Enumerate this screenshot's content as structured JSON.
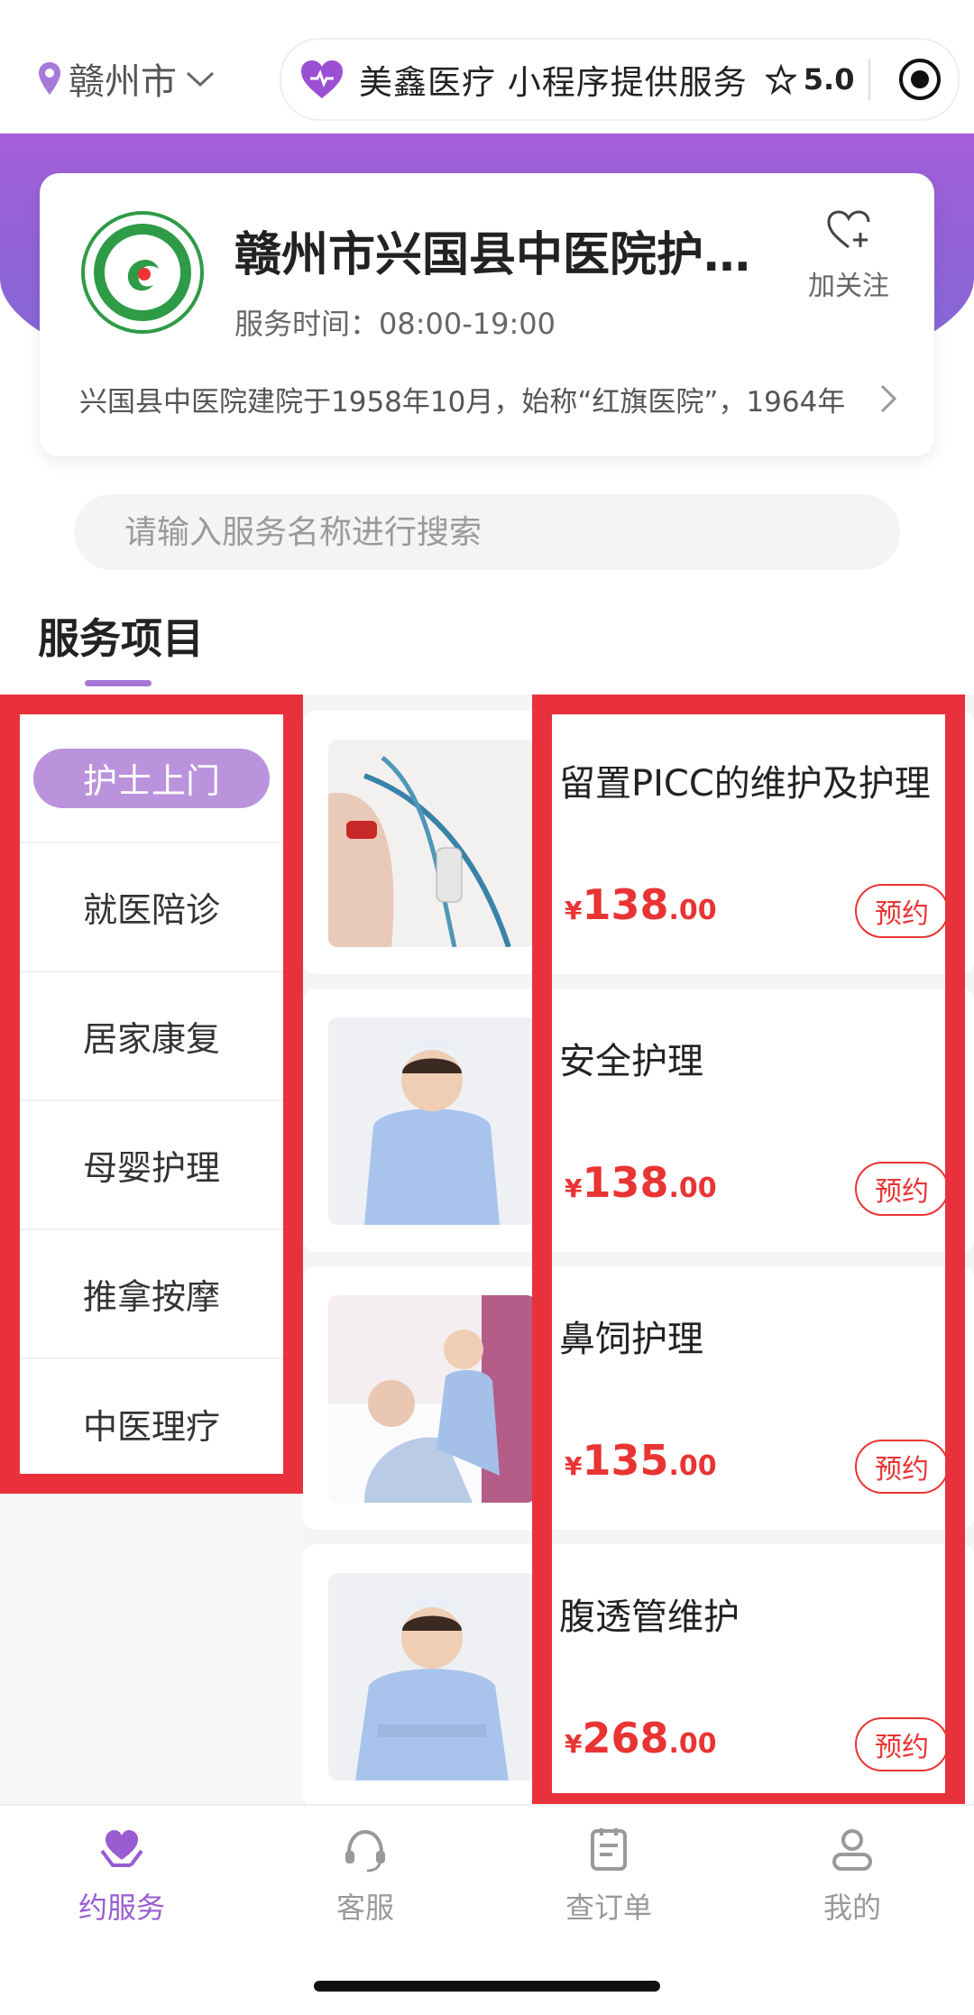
{
  "header": {
    "city": "赣州市",
    "miniprogram_name": "美鑫医疗 小程序提供服务",
    "rating": "5.0"
  },
  "hospital": {
    "name": "赣州市兴国县中医院护理质控中心",
    "hours": "服务时间：08:00-19:00",
    "follow_label": "加关注",
    "intro": "兴国县中医院建院于1958年10月，始称“红旗医院”，1964年"
  },
  "search": {
    "placeholder": "请输入服务名称进行搜索"
  },
  "section": {
    "title": "服务项目"
  },
  "categories": [
    {
      "label": "护士上门",
      "active": true
    },
    {
      "label": "就医陪诊"
    },
    {
      "label": "居家康复"
    },
    {
      "label": "母婴护理"
    },
    {
      "label": "推拿按摩"
    },
    {
      "label": "中医理疗"
    }
  ],
  "products": [
    {
      "name": "留置PICC的维护及护理",
      "currency": "¥",
      "price_int": "138",
      "price_dec": ".00",
      "book_label": "预约"
    },
    {
      "name": "安全护理",
      "currency": "¥",
      "price_int": "138",
      "price_dec": ".00",
      "book_label": "预约"
    },
    {
      "name": "鼻饲护理",
      "currency": "¥",
      "price_int": "135",
      "price_dec": ".00",
      "book_label": "预约"
    },
    {
      "name": "腹透管维护",
      "currency": "¥",
      "price_int": "268",
      "price_dec": ".00",
      "book_label": "预约"
    }
  ],
  "tabbar": [
    {
      "label": "约服务",
      "icon": "heart-hands-icon",
      "active": true
    },
    {
      "label": "客服",
      "icon": "headset-icon"
    },
    {
      "label": "查订单",
      "icon": "clipboard-icon"
    },
    {
      "label": "我的",
      "icon": "user-icon"
    }
  ],
  "colors": {
    "brand": "#9a5cd1",
    "price": "#e93434",
    "highlight_border": "#e8313b"
  }
}
